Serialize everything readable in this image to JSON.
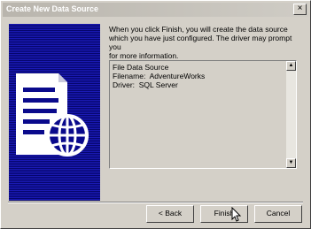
{
  "window": {
    "title": "Create New Data Source",
    "close_glyph": "×"
  },
  "intro_text": "When you click Finish, you will create the data source\nwhich you have just configured.  The driver may prompt you\nfor more information.",
  "summary": {
    "lines": "File Data Source\nFilename:  AdventureWorks\nDriver:  SQL Server"
  },
  "scrollbar": {
    "up_glyph": "▲",
    "down_glyph": "▼"
  },
  "buttons": {
    "back": "< Back",
    "finish": "Finish",
    "cancel": "Cancel"
  },
  "colors": {
    "banner": "#0a0a8c",
    "dialog_bg": "#d4d0c8",
    "title_text": "#ffffff"
  },
  "icons": [
    "close-icon",
    "document-globe-icon",
    "mouse-cursor-icon"
  ]
}
